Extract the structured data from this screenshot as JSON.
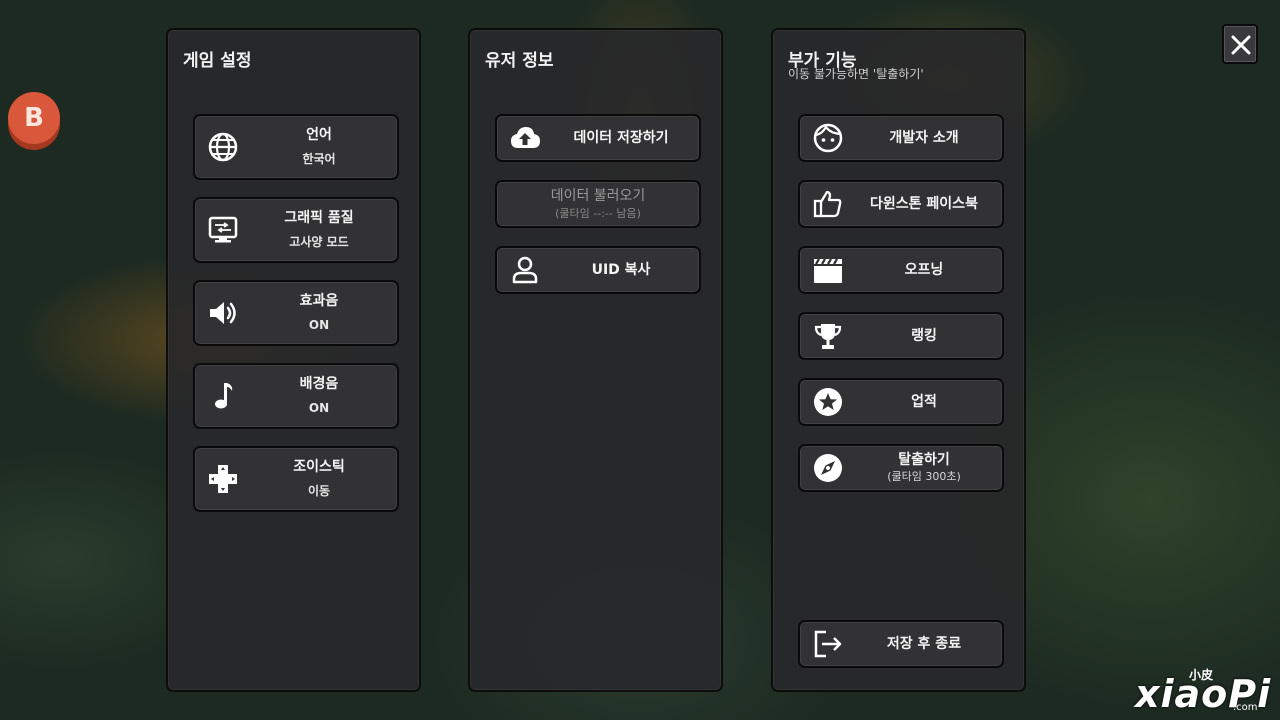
{
  "corner_badge": "B",
  "panels": {
    "game_settings": {
      "title": "게임 설정",
      "items": [
        {
          "label": "언어",
          "value": "한국어",
          "icon": "globe-icon"
        },
        {
          "label": "그래픽 품질",
          "value": "고사양 모드",
          "icon": "monitor-icon"
        },
        {
          "label": "효과음",
          "value": "ON",
          "icon": "speaker-icon"
        },
        {
          "label": "배경음",
          "value": "ON",
          "icon": "music-note-icon"
        },
        {
          "label": "조이스틱",
          "value": "이동",
          "icon": "dpad-icon"
        }
      ]
    },
    "user_info": {
      "title": "유저 정보",
      "save": {
        "label": "데이터 저장하기",
        "icon": "cloud-upload-icon"
      },
      "load": {
        "label": "데이터 불러오기",
        "sub": "(쿨타임 --:-- 남음)"
      },
      "uid": {
        "label": "UID 복사",
        "icon": "person-icon"
      }
    },
    "extra": {
      "title": "부가 기능",
      "subtitle": "이동 불가능하면 '탈출하기'",
      "items": [
        {
          "label": "개발자 소개",
          "icon": "face-icon"
        },
        {
          "label": "다윈스톤 페이스북",
          "icon": "thumbs-up-icon"
        },
        {
          "label": "오프닝",
          "icon": "clapperboard-icon"
        },
        {
          "label": "랭킹",
          "icon": "trophy-icon"
        },
        {
          "label": "업적",
          "icon": "star-badge-icon"
        },
        {
          "label": "탈출하기",
          "sub": "(쿨타임 300초)",
          "icon": "compass-icon"
        }
      ],
      "exit": {
        "label": "저장 후 종료",
        "icon": "exit-icon"
      }
    }
  },
  "watermark": {
    "small": "小皮",
    "big": "xiaoPi",
    "domain": ".com"
  }
}
